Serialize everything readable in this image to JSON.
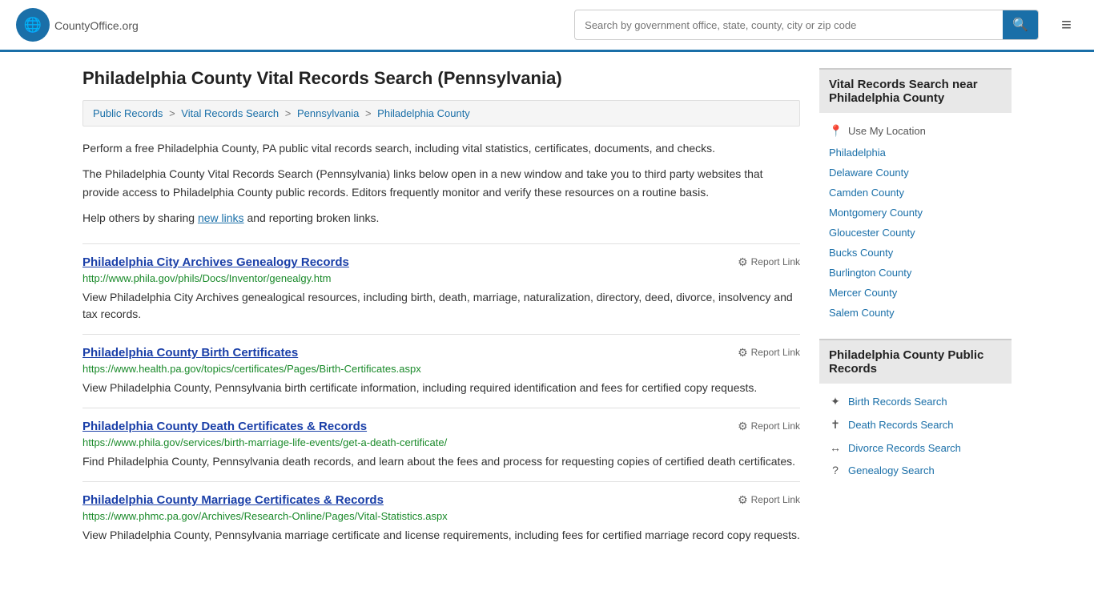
{
  "header": {
    "logo_icon": "🌐",
    "logo_name": "CountyOffice",
    "logo_suffix": ".org",
    "search_placeholder": "Search by government office, state, county, city or zip code",
    "search_button_icon": "🔍",
    "menu_icon": "≡"
  },
  "page": {
    "title": "Philadelphia County Vital Records Search (Pennsylvania)",
    "breadcrumb": [
      {
        "label": "Public Records",
        "href": "#"
      },
      {
        "label": "Vital Records Search",
        "href": "#"
      },
      {
        "label": "Pennsylvania",
        "href": "#"
      },
      {
        "label": "Philadelphia County",
        "href": "#"
      }
    ],
    "description1": "Perform a free Philadelphia County, PA public vital records search, including vital statistics, certificates, documents, and checks.",
    "description2": "The Philadelphia County Vital Records Search (Pennsylvania) links below open in a new window and take you to third party websites that provide access to Philadelphia County public records. Editors frequently monitor and verify these resources on a routine basis.",
    "help_text": "Help others by sharing",
    "help_link": "new links",
    "help_text2": "and reporting broken links."
  },
  "records": [
    {
      "title": "Philadelphia City Archives Genealogy Records",
      "url": "http://www.phila.gov/phils/Docs/Inventor/genealgy.htm",
      "description": "View Philadelphia City Archives genealogical resources, including birth, death, marriage, naturalization, directory, deed, divorce, insolvency and tax records.",
      "report_label": "Report Link"
    },
    {
      "title": "Philadelphia County Birth Certificates",
      "url": "https://www.health.pa.gov/topics/certificates/Pages/Birth-Certificates.aspx",
      "description": "View Philadelphia County, Pennsylvania birth certificate information, including required identification and fees for certified copy requests.",
      "report_label": "Report Link"
    },
    {
      "title": "Philadelphia County Death Certificates & Records",
      "url": "https://www.phila.gov/services/birth-marriage-life-events/get-a-death-certificate/",
      "description": "Find Philadelphia County, Pennsylvania death records, and learn about the fees and process for requesting copies of certified death certificates.",
      "report_label": "Report Link"
    },
    {
      "title": "Philadelphia County Marriage Certificates & Records",
      "url": "https://www.phmc.pa.gov/Archives/Research-Online/Pages/Vital-Statistics.aspx",
      "description": "View Philadelphia County, Pennsylvania marriage certificate and license requirements, including fees for certified marriage record copy requests.",
      "report_label": "Report Link"
    }
  ],
  "sidebar": {
    "nearby_section": {
      "title": "Vital Records Search near Philadelphia County",
      "use_location_label": "Use My Location",
      "links": [
        {
          "label": "Philadelphia"
        },
        {
          "label": "Delaware County"
        },
        {
          "label": "Camden County"
        },
        {
          "label": "Montgomery County"
        },
        {
          "label": "Gloucester County"
        },
        {
          "label": "Bucks County"
        },
        {
          "label": "Burlington County"
        },
        {
          "label": "Mercer County"
        },
        {
          "label": "Salem County"
        }
      ]
    },
    "public_records_section": {
      "title": "Philadelphia County Public Records",
      "items": [
        {
          "icon": "birth",
          "label": "Birth Records Search"
        },
        {
          "icon": "death",
          "label": "Death Records Search"
        },
        {
          "icon": "divorce",
          "label": "Divorce Records Search"
        },
        {
          "icon": "genealogy",
          "label": "Genealogy Search"
        }
      ]
    }
  }
}
